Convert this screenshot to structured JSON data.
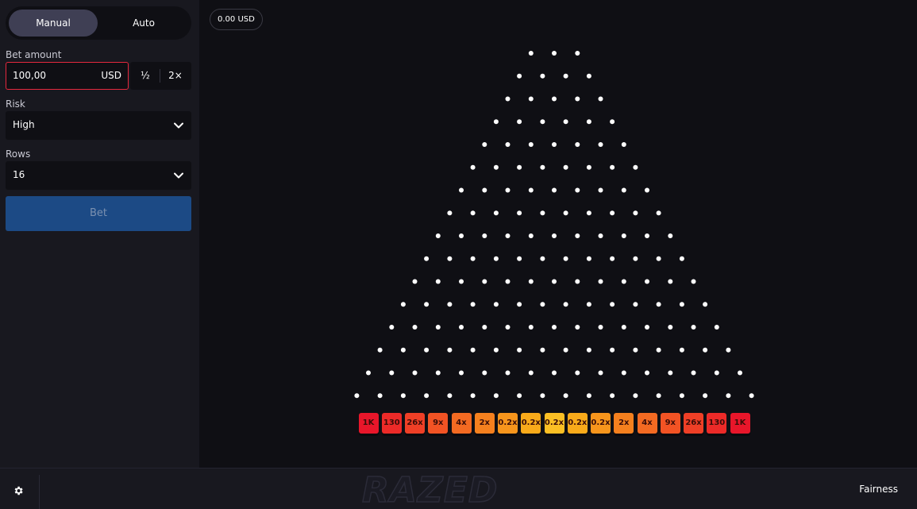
{
  "mode": {
    "manual_label": "Manual",
    "auto_label": "Auto",
    "active": "Manual"
  },
  "bet": {
    "label": "Bet amount",
    "value": "100,00",
    "currency": "USD",
    "half_label": "½",
    "double_label": "2×"
  },
  "risk": {
    "label": "Risk",
    "value": "High"
  },
  "rows": {
    "label": "Rows",
    "value": "16"
  },
  "bet_button": {
    "label": "Bet"
  },
  "balance": {
    "text": "0.00 USD"
  },
  "board": {
    "rows": 16,
    "multipliers": [
      "1K",
      "130",
      "26x",
      "9x",
      "4x",
      "2x",
      "0.2x",
      "0.2x",
      "0.2x",
      "0.2x",
      "0.2x",
      "2x",
      "4x",
      "9x",
      "26x",
      "130",
      "1K"
    ],
    "slot_colors": [
      "#e8162a",
      "#ec2a28",
      "#ef3f26",
      "#f25324",
      "#f36a22",
      "#f5801e",
      "#f7951c",
      "#f9aa1a",
      "#fbbf24",
      "#f9aa1a",
      "#f7951c",
      "#f5801e",
      "#f36a22",
      "#f25324",
      "#ef3f26",
      "#ec2a28",
      "#e8162a"
    ]
  },
  "footer": {
    "logo": "RAZED",
    "fairness_label": "Fairness",
    "settings_icon": "gear-icon"
  },
  "colors": {
    "accent_red": "#e5283e",
    "bet_button": "#1c4a85",
    "panel": "#18181f",
    "background": "#0f0f14"
  }
}
